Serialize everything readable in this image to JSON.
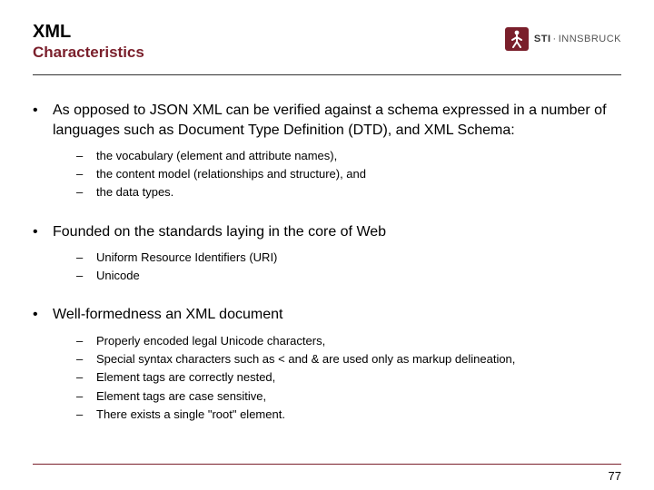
{
  "header": {
    "title": "XML",
    "subtitle": "Characteristics",
    "logo_bold": "STI",
    "logo_rest": "INNSBRUCK"
  },
  "sections": [
    {
      "text": "As opposed to JSON XML can be verified against a schema expressed in a number of languages such as Document Type Definition (DTD), and XML Schema:",
      "subs": [
        "the vocabulary (element and attribute names),",
        "the content model (relationships and structure), and",
        "the data types."
      ]
    },
    {
      "text": "Founded on the standards laying in the core of Web",
      "subs": [
        "Uniform Resource Identifiers (URI)",
        "Unicode"
      ]
    },
    {
      "text": "Well-formedness an XML document",
      "subs": [
        "Properly encoded legal Unicode characters,",
        "Special syntax characters such as < and & are used only as markup delineation,",
        "Element tags are correctly nested,",
        "Element tags are case sensitive,",
        "There exists a single \"root\" element."
      ]
    }
  ],
  "page_number": "77"
}
